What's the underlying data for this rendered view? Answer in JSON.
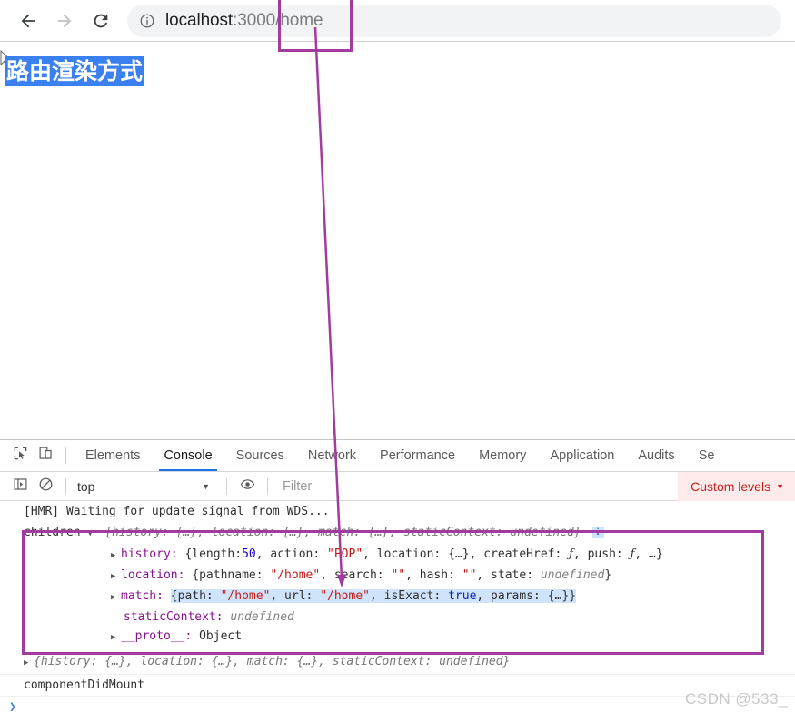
{
  "browser": {
    "back_label": "Back",
    "forward_label": "Forward",
    "reload_label": "Reload",
    "site_info_label": "View site information",
    "url": {
      "host": "localhost",
      "port": ":3000",
      "path": "/home"
    }
  },
  "page": {
    "heading": "路由渲染方式"
  },
  "devtools": {
    "inspect_label": "Inspect element",
    "device_label": "Toggle device toolbar",
    "tabs": [
      {
        "label": "Elements",
        "active": false
      },
      {
        "label": "Console",
        "active": true
      },
      {
        "label": "Sources",
        "active": false
      },
      {
        "label": "Network",
        "active": false
      },
      {
        "label": "Performance",
        "active": false
      },
      {
        "label": "Memory",
        "active": false
      },
      {
        "label": "Application",
        "active": false
      },
      {
        "label": "Audits",
        "active": false
      },
      {
        "label": "Se",
        "active": false
      }
    ],
    "filterbar": {
      "sidebar_toggle_label": "Show console sidebar",
      "clear_label": "Clear console",
      "context": "top",
      "context_caret": "▼",
      "eye_label": "Live expression",
      "filter_placeholder": "Filter",
      "levels_label": "Custom levels",
      "levels_caret": "▼"
    },
    "console": {
      "line_hmr": "[HMR] Waiting for update signal from WDS...",
      "obj_label": "children",
      "obj_caret_open": "▼",
      "obj_caret_closed": "▶",
      "obj_summary_open": "{history: {…}, location: {…}, match: {…}, staticContext: undefined}",
      "info_badge": "i",
      "row_history": {
        "key": "history:",
        "brace_open": "{length:",
        "length_value": "50",
        "action_key": ", action:",
        "action_value": "\"POP\"",
        "location_key": ", location:",
        "location_value": "{…}",
        "createhref_key": ", createHref:",
        "createhref_value": "ƒ",
        "push_key": ", push:",
        "push_value": "ƒ",
        "tail": ", …}"
      },
      "row_location": {
        "key": "location:",
        "brace_open": "{pathname:",
        "pathname_value": "\"/home\"",
        "search_key": ", search:",
        "search_value": "\"\"",
        "hash_key": ", hash:",
        "hash_value": "\"\"",
        "state_key": ", state:",
        "state_value": "undefined",
        "tail": "}"
      },
      "row_match": {
        "key": "match:",
        "brace_open": "{path:",
        "path_value": "\"/home\"",
        "url_key": ", url:",
        "url_value": "\"/home\"",
        "isexact_key": ", isExact:",
        "isexact_value": "true",
        "params_key": ", params:",
        "params_value": "{…}",
        "tail": "}"
      },
      "row_staticcontext": {
        "key": "staticContext:",
        "value": "undefined"
      },
      "row_proto": {
        "key": "__proto__:",
        "value": "Object"
      },
      "line_collapsed_obj": "{history: {…}, location: {…}, match: {…}, staticContext: undefined}",
      "line_didmount": "componentDidMount",
      "prompt": "❯"
    }
  },
  "annotations": {
    "url_box_label": "url-path-highlight",
    "console_box_label": "console-object-highlight",
    "arrow_label": "url-to-pathname-arrow"
  },
  "watermark": "CSDN @533_"
}
